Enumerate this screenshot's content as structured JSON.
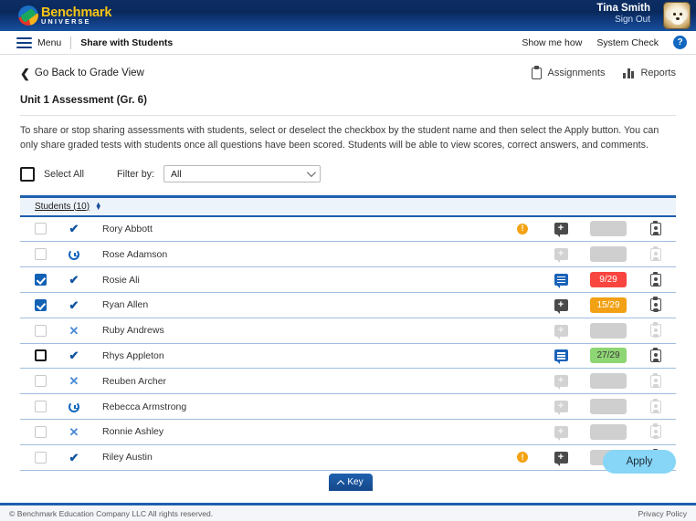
{
  "brand": {
    "name_primary": "Benchmark",
    "name_secondary": "UNIVERSE",
    "logo_icon": "benchmark-universe-logo"
  },
  "topbar": {
    "user_name": "Tina Smith",
    "sign_out_label": "Sign Out",
    "avatar_icon": "dog-avatar"
  },
  "navbar": {
    "menu_label": "Menu",
    "menu_icon": "hamburger-icon",
    "breadcrumb": "Share with Students",
    "show_me_how_label": "Show me how",
    "system_check_label": "System Check",
    "help_icon": "question-mark-icon",
    "help_glyph": "?"
  },
  "subnav": {
    "back_label": "Go Back to Grade View",
    "back_icon": "chevron-left-icon",
    "assignments_label": "Assignments",
    "assignments_icon": "clipboard-icon",
    "reports_label": "Reports",
    "reports_icon": "bar-chart-icon"
  },
  "page": {
    "title": "Unit 1 Assessment (Gr. 6)",
    "instructions": "To share or stop sharing assessments with students, select or deselect the checkbox by the student name and then select the Apply button. You can only share graded tests with students once all questions have been scored. Students will be able to view scores, correct answers, and comments."
  },
  "toolbar": {
    "select_all_label": "Select All",
    "filter_label": "Filter by:",
    "filter_value": "All",
    "filter_options": [
      "All"
    ],
    "chevron_icon": "chevron-down-icon"
  },
  "table": {
    "header_label": "Students (10)",
    "sort_icon": "sort-arrows-icon",
    "rows": [
      {
        "name": "Rory Abbott",
        "checked": false,
        "focused": false,
        "status": "check",
        "alert": true,
        "note": "add",
        "note_dim": false,
        "score": "",
        "score_color": "empty",
        "report_dim": false
      },
      {
        "name": "Rose Adamson",
        "checked": false,
        "focused": false,
        "status": "clock",
        "alert": false,
        "note": "add",
        "note_dim": true,
        "score": "",
        "score_color": "empty",
        "report_dim": true
      },
      {
        "name": "Rosie Ali",
        "checked": true,
        "focused": false,
        "status": "check",
        "alert": false,
        "note": "msg",
        "note_dim": false,
        "score": "9/29",
        "score_color": "red",
        "report_dim": false
      },
      {
        "name": "Ryan Allen",
        "checked": true,
        "focused": false,
        "status": "check",
        "alert": false,
        "note": "add",
        "note_dim": false,
        "score": "15/29",
        "score_color": "orange",
        "report_dim": false
      },
      {
        "name": "Ruby Andrews",
        "checked": false,
        "focused": false,
        "status": "x",
        "alert": false,
        "note": "add",
        "note_dim": true,
        "score": "",
        "score_color": "empty",
        "report_dim": true
      },
      {
        "name": "Rhys Appleton",
        "checked": false,
        "focused": true,
        "status": "check",
        "alert": false,
        "note": "msg",
        "note_dim": false,
        "score": "27/29",
        "score_color": "green",
        "report_dim": false
      },
      {
        "name": "Reuben Archer",
        "checked": false,
        "focused": false,
        "status": "x",
        "alert": false,
        "note": "add",
        "note_dim": true,
        "score": "",
        "score_color": "empty",
        "report_dim": true
      },
      {
        "name": "Rebecca Armstrong",
        "checked": false,
        "focused": false,
        "status": "clock",
        "alert": false,
        "note": "add",
        "note_dim": true,
        "score": "",
        "score_color": "empty",
        "report_dim": true
      },
      {
        "name": "Ronnie Ashley",
        "checked": false,
        "focused": false,
        "status": "x",
        "alert": false,
        "note": "add",
        "note_dim": true,
        "score": "",
        "score_color": "empty",
        "report_dim": true
      },
      {
        "name": "Riley Austin",
        "checked": false,
        "focused": false,
        "status": "check",
        "alert": true,
        "note": "add",
        "note_dim": false,
        "score": "",
        "score_color": "empty",
        "report_dim": false
      }
    ]
  },
  "actions": {
    "apply_label": "Apply",
    "key_label": "Key",
    "key_icon": "chevron-up-icon"
  },
  "footer": {
    "copyright": "© Benchmark Education Company LLC All rights reserved.",
    "privacy_label": "Privacy Policy"
  },
  "colors": {
    "brand_blue": "#0c2d63",
    "accent_blue": "#1f5fae",
    "score_red": "#f9453f",
    "score_orange": "#f2a114",
    "score_green": "#8ed573",
    "alert_orange": "#f5a212",
    "apply_blue": "#87d6f7"
  }
}
